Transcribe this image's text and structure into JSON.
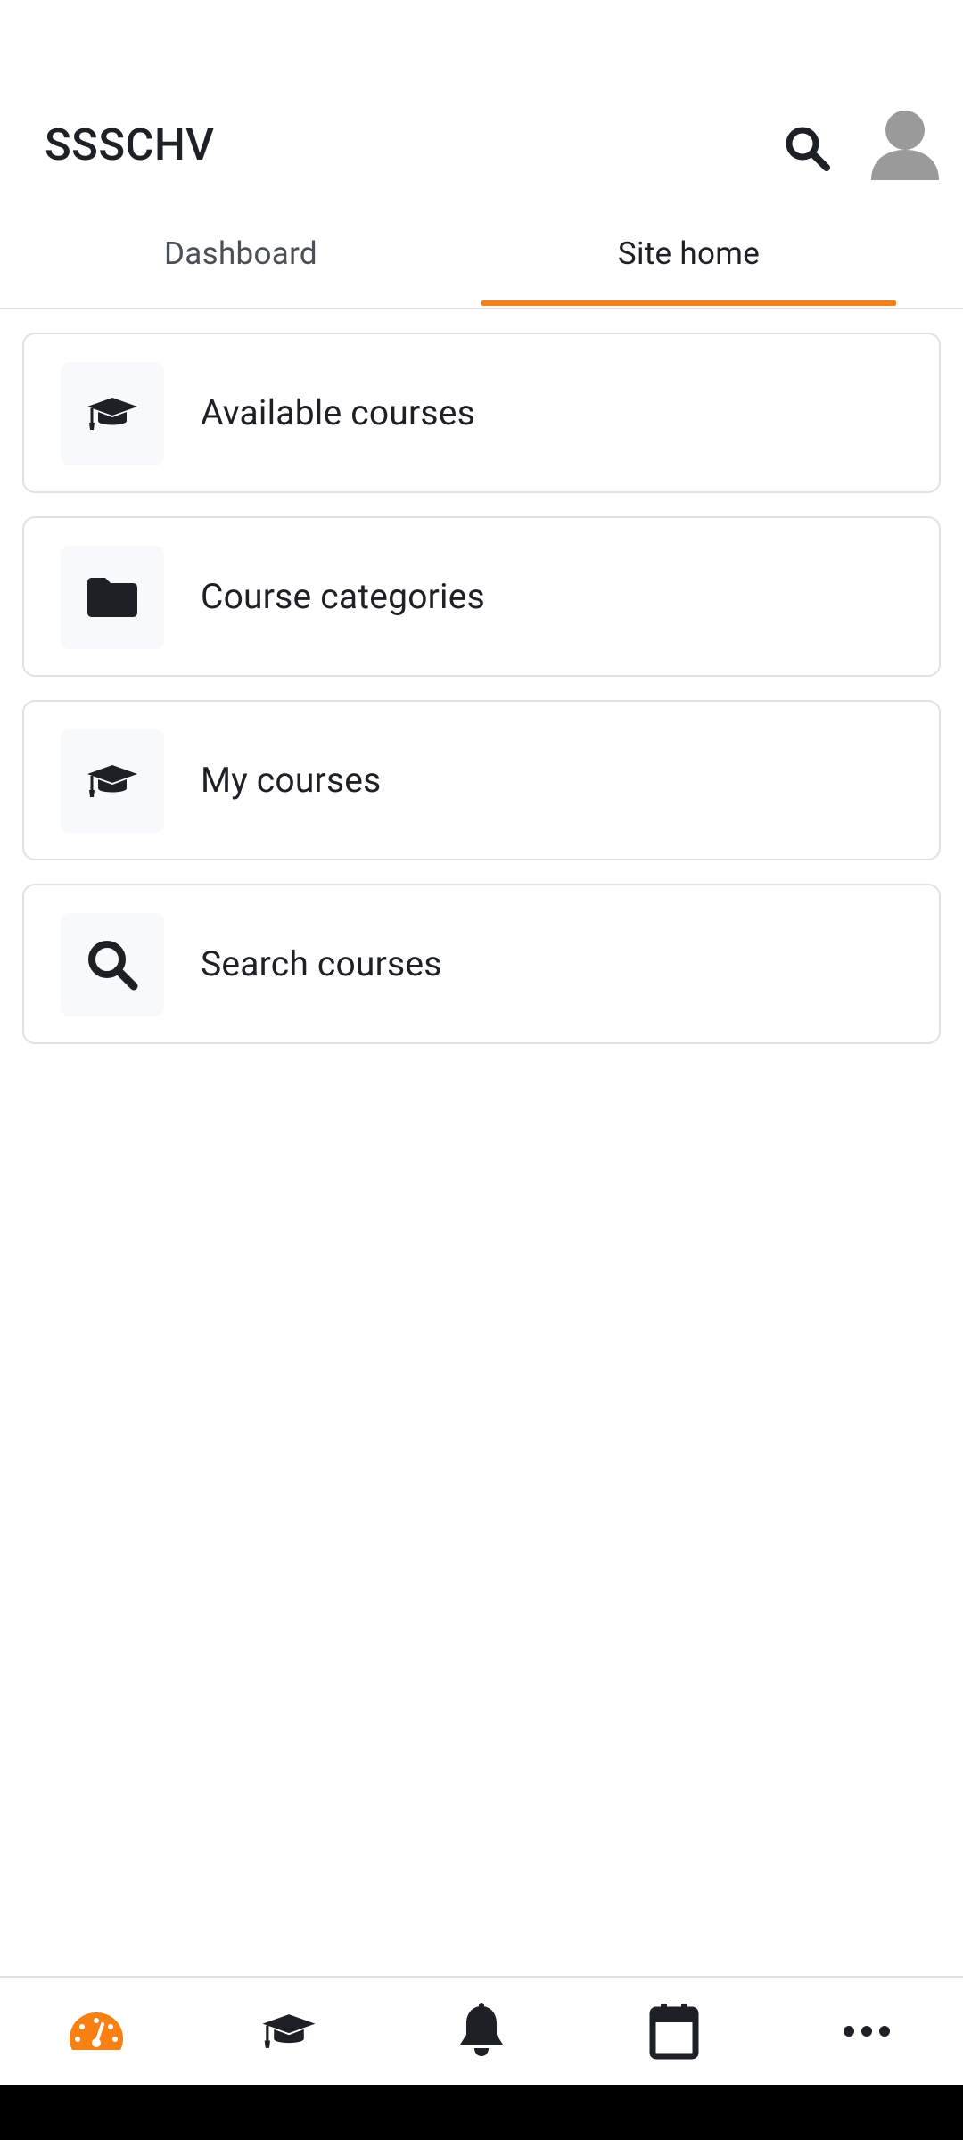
{
  "header": {
    "site_name": "SSSCHV",
    "search_icon": "search-icon",
    "avatar_icon": "user-avatar-icon"
  },
  "tabs": [
    {
      "label": "Dashboard",
      "active": false
    },
    {
      "label": "Site home",
      "active": true
    }
  ],
  "menu": [
    {
      "label": "Available courses",
      "icon": "graduation-cap-icon"
    },
    {
      "label": "Course categories",
      "icon": "folder-icon"
    },
    {
      "label": "My courses",
      "icon": "graduation-cap-icon"
    },
    {
      "label": "Search courses",
      "icon": "search-icon"
    }
  ],
  "bottom_nav": [
    {
      "icon": "dashboard-gauge-icon",
      "active": true
    },
    {
      "icon": "graduation-cap-icon",
      "active": false
    },
    {
      "icon": "bell-icon",
      "active": false
    },
    {
      "icon": "calendar-icon",
      "active": false
    },
    {
      "icon": "more-dots-icon",
      "active": false
    }
  ],
  "colors": {
    "accent": "#f98012",
    "text": "#1d2125",
    "muted_text": "#495057",
    "border": "#dee2e6",
    "icon_bg": "#f8f9fa",
    "avatar": "#9a9a9a"
  }
}
